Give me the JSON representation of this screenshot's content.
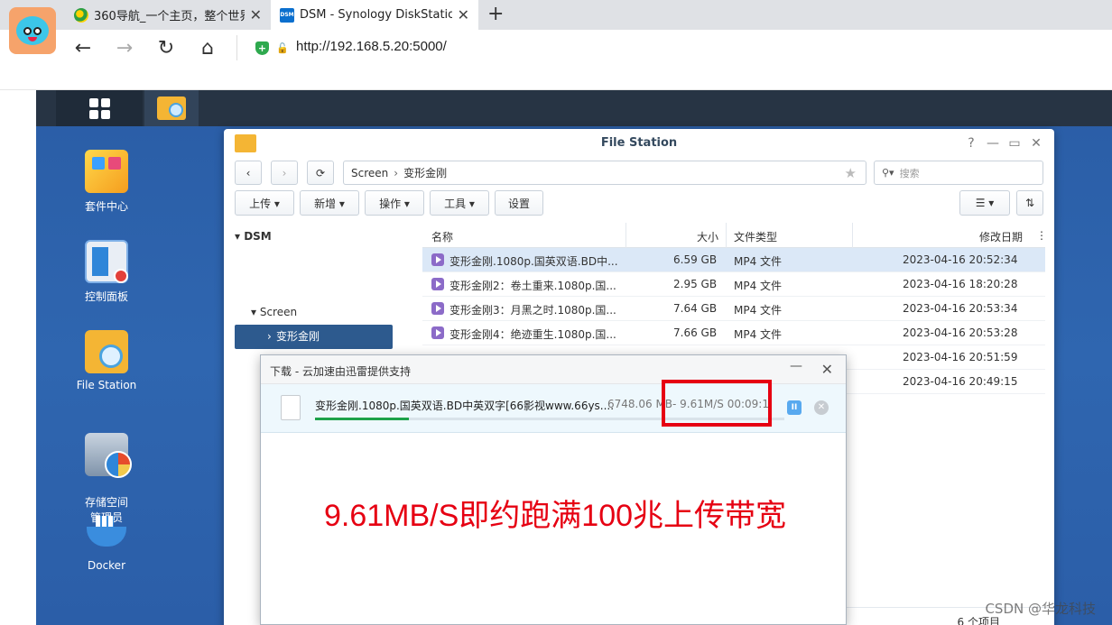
{
  "browser": {
    "tabs": [
      {
        "title": "360导航_一个主页，整个世界",
        "close": "✕"
      },
      {
        "title": "DSM - Synology DiskStation",
        "close": "✕"
      }
    ],
    "new_tab": "+",
    "url": "http://192.168.5.20:5000/"
  },
  "dsm": {
    "desktop": [
      {
        "label": "套件中心"
      },
      {
        "label": "控制面板"
      },
      {
        "label": "File Station"
      },
      {
        "label": "存储空间\n管理员"
      },
      {
        "label": "Docker"
      }
    ]
  },
  "file_station": {
    "title": "File Station",
    "controls": {
      "help": "?",
      "minimize": "—",
      "maximize": "▭",
      "close": "✕"
    },
    "path": {
      "root": "Screen",
      "sep": "›",
      "current": "变形金刚"
    },
    "search_placeholder": "搜索",
    "toolbar": {
      "upload": "上传 ▾",
      "create": "新增 ▾",
      "action": "操作 ▾",
      "tools": "工具 ▾",
      "settings": "设置"
    },
    "tree": {
      "root": "DSM",
      "folder": "Screen",
      "selected": "变形金刚"
    },
    "columns": {
      "name": "名称",
      "size": "大小",
      "type": "文件类型",
      "modified": "修改日期"
    },
    "rows": [
      {
        "name": "变形金刚.1080p.国英双语.BD中...",
        "size": "6.59 GB",
        "type": "MP4 文件",
        "modified": "2023-04-16 20:52:34"
      },
      {
        "name": "变形金刚2：卷土重来.1080p.国...",
        "size": "2.95 GB",
        "type": "MP4 文件",
        "modified": "2023-04-16 18:20:28"
      },
      {
        "name": "变形金刚3：月黑之时.1080p.国...",
        "size": "7.64 GB",
        "type": "MP4 文件",
        "modified": "2023-04-16 20:53:34"
      },
      {
        "name": "变形金刚4：绝迹重生.1080p.国...",
        "size": "7.66 GB",
        "type": "MP4 文件",
        "modified": "2023-04-16 20:53:28"
      },
      {
        "name": "",
        "size": "",
        "type": "",
        "modified": "2023-04-16 20:51:59"
      },
      {
        "name": "",
        "size": "",
        "type": "",
        "modified": "2023-04-16 20:49:15"
      }
    ],
    "item_count": "6 个项目"
  },
  "download": {
    "title": "下载 - 云加速由迅雷提供支持",
    "min": "—",
    "close": "✕",
    "file_name": "变形金刚.1080p.国英双语.BD中英双字[66影视www.66ys....",
    "file_size": "6748.06 MB",
    "speed": "- 9.61M/S  00:09:1",
    "progress": 0.2,
    "pause": "II",
    "cancel": "✕",
    "annotation": "9.61MB/S即约跑满100兆上传带宽"
  },
  "watermark": "CSDN @华龙科技",
  "colors": {
    "annotation": "#e60012",
    "dsm_bg": "#2f66b0",
    "selected_tree": "#2d5a8e",
    "progress": "#1ea24a"
  }
}
